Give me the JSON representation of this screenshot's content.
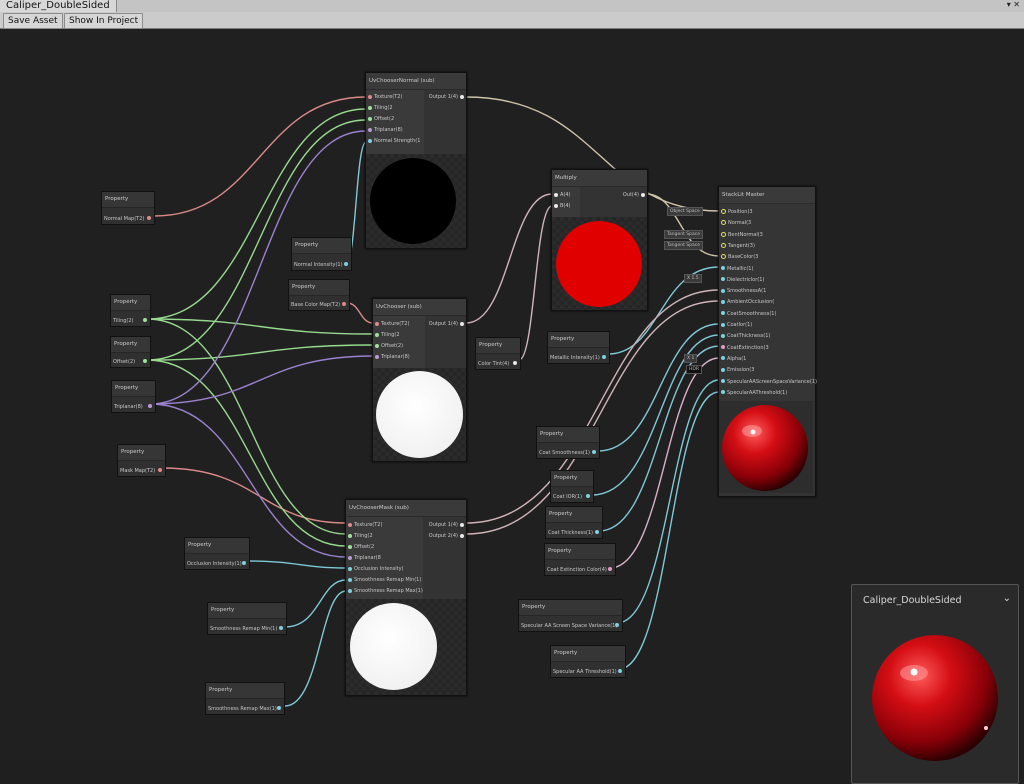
{
  "window": {
    "tab_title": "Caliper_DoubleSided",
    "controls": "▾ ✕"
  },
  "toolbar": {
    "save_asset": "Save Asset",
    "show_in_project": "Show In Project"
  },
  "colors": {
    "texture": "#e08a8a",
    "vector2": "#9ee29a",
    "vector4": "#b79ad8",
    "vector1": "#7fd0e0",
    "color": "#e39ac2",
    "red": "#e00000",
    "white": "#ffffff",
    "master_port": "#e8e070"
  },
  "nodes": {
    "uv_normal": {
      "title": "UvChooserNormal (sub)",
      "inputs": [
        "Texture(T2)",
        "Tiling(2",
        "Offset(2",
        "Triplanar(8)",
        "Normal Strength(1"
      ],
      "outputs": [
        "Output 1(4)"
      ]
    },
    "uv_chooser": {
      "title": "UvChooser (sub)",
      "inputs": [
        "Texture(T2)",
        "Tiling(2",
        "Offset(2)",
        "Triplanar(8)"
      ],
      "outputs": [
        "Output 1(4)"
      ]
    },
    "uv_mask": {
      "title": "UvChooserMask (sub)",
      "inputs": [
        "Texture(T2)",
        "Tiling(2",
        "Offset(2",
        "Triplanar(8",
        "Occlusion Intensity(",
        "Smoothness Remap Min(1)",
        "Smoothness Remap Max(1)"
      ],
      "outputs": [
        "Output 1(4)",
        "Output 2(4)"
      ]
    },
    "multiply": {
      "title": "Multiply",
      "inputs": [
        "A(4)",
        "B(4)"
      ],
      "outputs": [
        "Out(4)"
      ]
    },
    "master": {
      "title": "StackLit Master",
      "inputs": [
        "Position(3",
        "Normal(3",
        "BentNormal(3",
        "Tangent(3)",
        "BaseColor(3",
        "Metallic(1)",
        "DielectricIor(1)",
        "SmoothnessA(1",
        "AmbientOcclusion(",
        "CoatSmoothness(1)",
        "CoatIor(1)",
        "CoatThickness(1)",
        "CoatExtinction(3",
        "Alpha(1",
        "Emission(3",
        "SpecularAAScreenSpaceVariance(1)",
        "SpecularAAThreshold(1)"
      ]
    }
  },
  "master_tags": {
    "object_space": "Object Space",
    "tangent_space_1": "Tangent Space",
    "tangent_space_2": "Tangent Space",
    "dielectric_val": "X 1.5",
    "alpha_val": "X 1",
    "emission_val": "HDR"
  },
  "properties": [
    {
      "id": "normal_map",
      "header": "Property",
      "label": "Normal Map(T2)"
    },
    {
      "id": "normal_intensity",
      "header": "Property",
      "label": "Normal Intensity(1)"
    },
    {
      "id": "tiling",
      "header": "Property",
      "label": "Tiling(2)"
    },
    {
      "id": "offset",
      "header": "Property",
      "label": "Offset(2)"
    },
    {
      "id": "triplanar",
      "header": "Property",
      "label": "Triplanar(8)"
    },
    {
      "id": "base_color_map",
      "header": "Property",
      "label": "Base Color Map(T2)"
    },
    {
      "id": "color_tint",
      "header": "Property",
      "label": "Color Tint(4)"
    },
    {
      "id": "metallic_intensity",
      "header": "Property",
      "label": "Metallic Intensity(1)"
    },
    {
      "id": "mask_map",
      "header": "Property",
      "label": "Mask Map(T2)"
    },
    {
      "id": "occlusion_intensity",
      "header": "Property",
      "label": "Occlusion Intensity(1)"
    },
    {
      "id": "smoothness_min",
      "header": "Property",
      "label": "Smoothness Remap Min(1)"
    },
    {
      "id": "smoothness_max",
      "header": "Property",
      "label": "Smoothness Remap Max(1)"
    },
    {
      "id": "coat_smoothness",
      "header": "Property",
      "label": "Coat Smoothness(1)"
    },
    {
      "id": "coat_ior",
      "header": "Property",
      "label": "Coat IOR(1)"
    },
    {
      "id": "coat_thickness",
      "header": "Property",
      "label": "Coat Thickness(1)"
    },
    {
      "id": "coat_extinction",
      "header": "Property",
      "label": "Coat Extinction Color(4)"
    },
    {
      "id": "spec_aa_variance",
      "header": "Property",
      "label": "Specular AA Screen Space Variance(1)"
    },
    {
      "id": "spec_aa_threshold",
      "header": "Property",
      "label": "Specular AA Threshold(1)"
    }
  ],
  "preview_window": {
    "title": "Caliper_DoubleSided"
  }
}
